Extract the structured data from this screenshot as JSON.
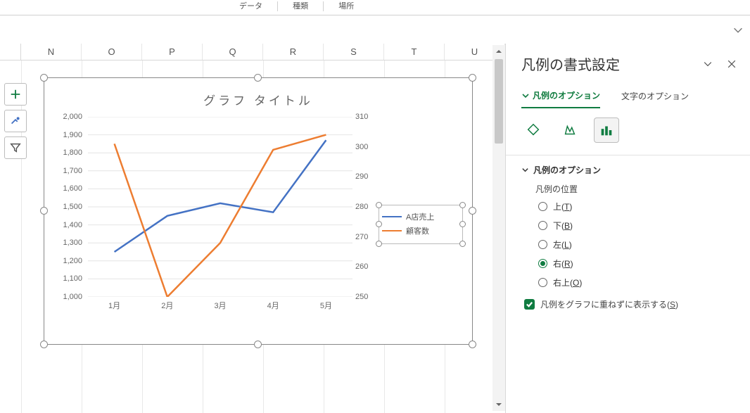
{
  "ribbon": {
    "group1": "データ",
    "group2": "種類",
    "group3": "場所"
  },
  "columns": [
    "N",
    "O",
    "P",
    "Q",
    "R",
    "S",
    "T",
    "U"
  ],
  "side_tools": {
    "plus": "add-element",
    "brush": "chart-styles",
    "funnel": "chart-filters"
  },
  "legend": {
    "series_a": "A店売上",
    "series_b": "顧客数"
  },
  "pane": {
    "title": "凡例の書式設定",
    "tab_options": "凡例のオプション",
    "tab_text": "文字のオプション",
    "section": "凡例のオプション",
    "pos_label": "凡例の位置",
    "r_top": "上(",
    "r_top_k": "T",
    "r_top_e": ")",
    "r_bottom": "下(",
    "r_bottom_k": "B",
    "r_bottom_e": ")",
    "r_left": "左(",
    "r_left_k": "L",
    "r_left_e": ")",
    "r_right": "右(",
    "r_right_k": "R",
    "r_right_e": ")",
    "r_topr": "右上(",
    "r_topr_k": "O",
    "r_topr_e": ")",
    "chk_label": "凡例をグラフに重ねずに表示する(",
    "chk_k": "S",
    "chk_e": ")"
  },
  "chart_data": {
    "type": "line",
    "title": "グラフ タイトル",
    "categories": [
      "1月",
      "2月",
      "3月",
      "4月",
      "5月"
    ],
    "series": [
      {
        "name": "A店売上",
        "axis": "primary",
        "values": [
          1250,
          1450,
          1520,
          1470,
          1870
        ],
        "color": "#4472c4"
      },
      {
        "name": "顧客数",
        "axis": "secondary",
        "values": [
          301,
          250,
          268,
          299,
          304
        ],
        "color": "#ed7d31"
      }
    ],
    "y_primary": {
      "label": "",
      "min": 1000,
      "max": 2000,
      "ticks": [
        1000,
        1100,
        1200,
        1300,
        1400,
        1500,
        1600,
        1700,
        1800,
        1900,
        2000
      ]
    },
    "y_secondary": {
      "label": "",
      "min": 250,
      "max": 310,
      "ticks": [
        250,
        260,
        270,
        280,
        290,
        300,
        310
      ]
    },
    "xlabel": "",
    "legend_position": "right",
    "grid": true
  }
}
